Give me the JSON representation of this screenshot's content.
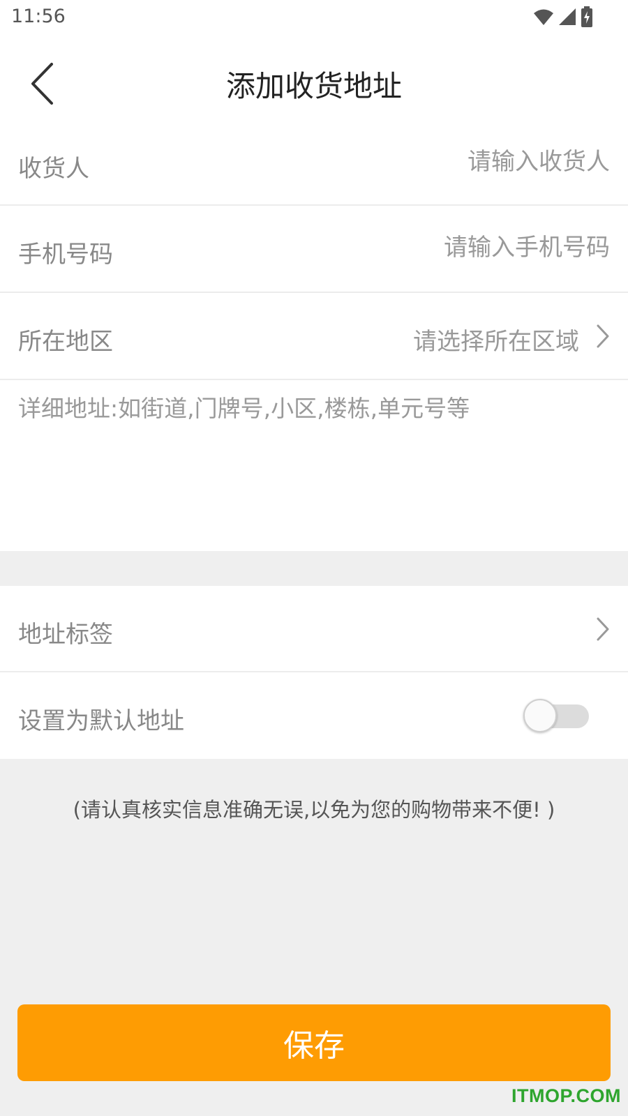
{
  "status_bar": {
    "time": "11:56",
    "icons": [
      "wifi-icon",
      "signal-icon",
      "battery-charging-icon"
    ]
  },
  "header": {
    "back_icon": "chevron-left-icon",
    "title": "添加收货地址"
  },
  "form": {
    "recipient": {
      "label": "收货人",
      "placeholder": "请输入收货人",
      "value": ""
    },
    "phone": {
      "label": "手机号码",
      "placeholder": "请输入手机号码",
      "value": ""
    },
    "region": {
      "label": "所在地区",
      "value": "请选择所在区域",
      "icon": "chevron-right-icon"
    },
    "address_detail": {
      "placeholder": "详细地址:如街道,门牌号,小区,楼栋,单元号等",
      "value": ""
    },
    "address_tag": {
      "label": "地址标签",
      "icon": "chevron-right-icon"
    },
    "default_address": {
      "label": "设置为默认地址",
      "enabled": false
    }
  },
  "notice": "(请认真核实信息准确无误,以免为您的购物带来不便! )",
  "save_label": "保存",
  "watermark": "ITMOP.COM",
  "colors": {
    "accent": "#fe9c03",
    "background": "#efefef",
    "watermark": "#2ea52e"
  }
}
